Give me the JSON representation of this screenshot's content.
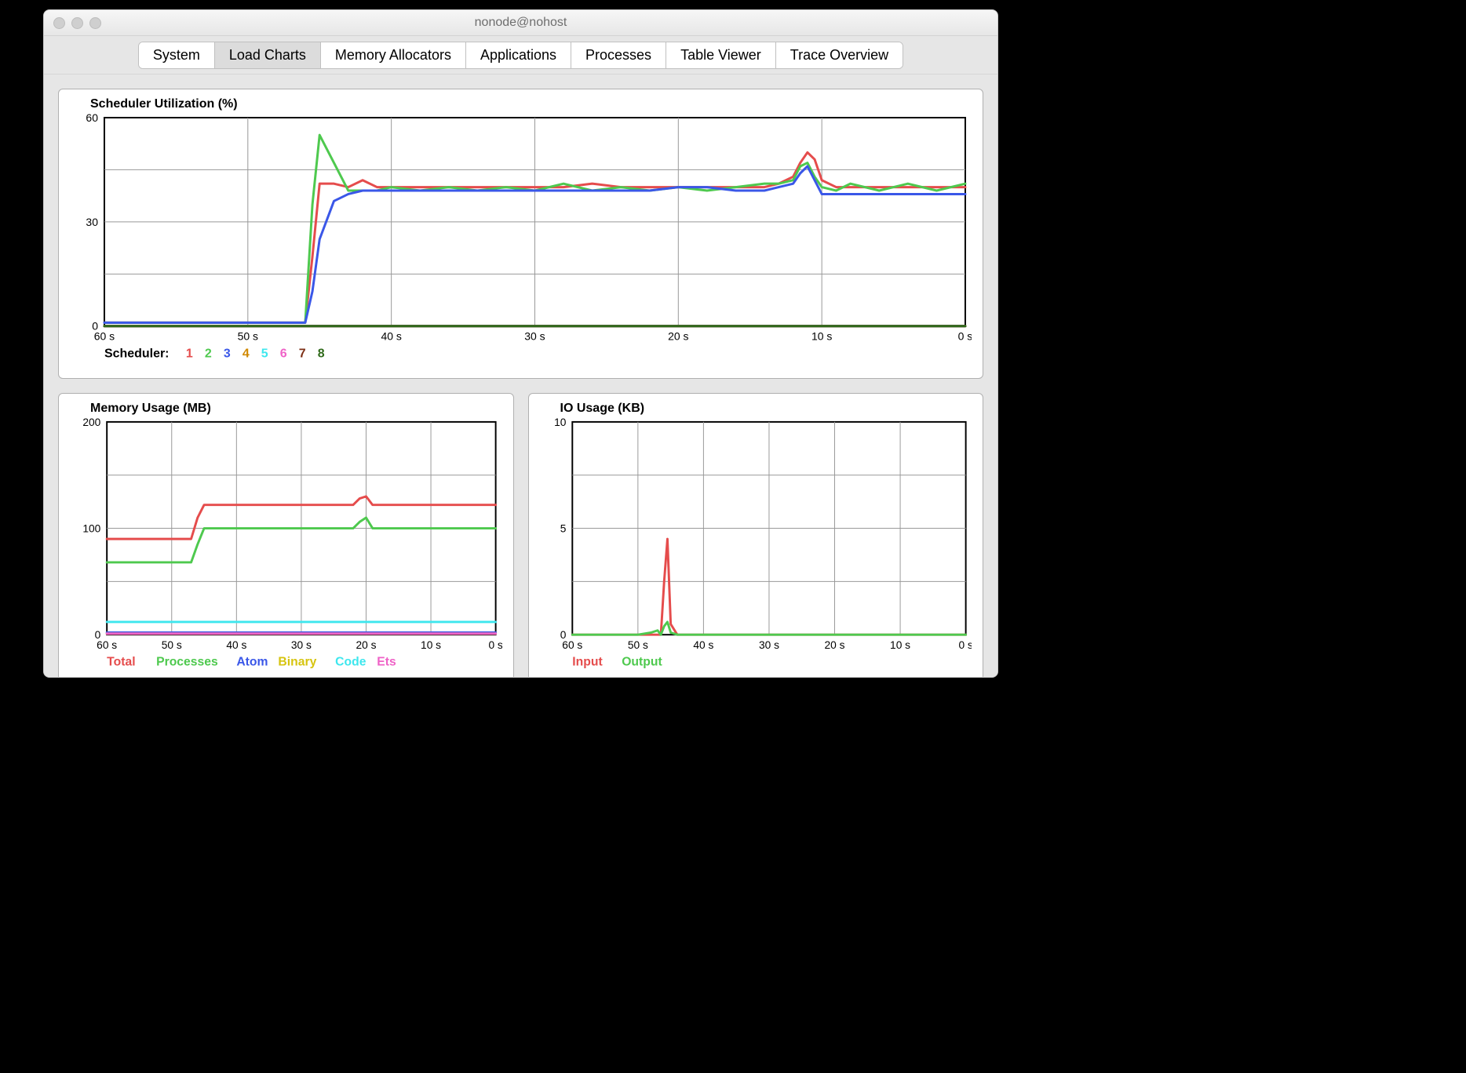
{
  "window": {
    "title": "nonode@nohost"
  },
  "tabs": {
    "selected_index": 1,
    "items": [
      "System",
      "Load Charts",
      "Memory Allocators",
      "Applications",
      "Processes",
      "Table Viewer",
      "Trace Overview"
    ]
  },
  "colors": {
    "red": "#e54c4c",
    "green": "#4ec94e",
    "blue": "#3a57e8",
    "yellow": "#d6c40f",
    "cyan": "#3ee7ee",
    "magenta": "#ef62c7",
    "darkred": "#7d2f16",
    "darkgreen": "#2f6a1a",
    "orange": "#d08800"
  },
  "chart_data": [
    {
      "id": "scheduler",
      "type": "line",
      "title": "Scheduler Utilization (%)",
      "xlabel": "",
      "ylabel": "",
      "xlim": [
        60,
        0
      ],
      "ylim": [
        0,
        60
      ],
      "x_ticks": [
        "60 s",
        "50 s",
        "40 s",
        "30 s",
        "20 s",
        "10 s",
        "0 s"
      ],
      "y_ticks": [
        0,
        30,
        60
      ],
      "legend_prefix": "Scheduler:",
      "legend": [
        {
          "name": "1",
          "color": "red"
        },
        {
          "name": "2",
          "color": "green"
        },
        {
          "name": "3",
          "color": "blue"
        },
        {
          "name": "4",
          "color": "orange"
        },
        {
          "name": "5",
          "color": "cyan"
        },
        {
          "name": "6",
          "color": "magenta"
        },
        {
          "name": "7",
          "color": "darkred"
        },
        {
          "name": "8",
          "color": "darkgreen"
        }
      ],
      "x": [
        60,
        55,
        50,
        47.5,
        46.5,
        46,
        45.5,
        45,
        44,
        43,
        42,
        41,
        40,
        38,
        36,
        34,
        32,
        30,
        28,
        26,
        24,
        22,
        20,
        18,
        16,
        14,
        13,
        12,
        11.5,
        11,
        10.5,
        10,
        9,
        8,
        6,
        4,
        2,
        0
      ],
      "series": [
        {
          "name": "1",
          "color": "red",
          "y": [
            1,
            1,
            1,
            1,
            1,
            1,
            20,
            41,
            41,
            40,
            42,
            40,
            40,
            40,
            40,
            40,
            40,
            40,
            40,
            41,
            40,
            40,
            40,
            40,
            40,
            40,
            41,
            43,
            47,
            50,
            48,
            42,
            40,
            40,
            40,
            40,
            40,
            40
          ]
        },
        {
          "name": "2",
          "color": "green",
          "y": [
            1,
            1,
            1,
            1,
            1,
            1,
            35,
            55,
            47,
            39,
            39,
            39,
            40,
            39,
            40,
            39,
            40,
            39,
            41,
            39,
            40,
            39,
            40,
            39,
            40,
            41,
            41,
            42,
            46,
            47,
            43,
            40,
            39,
            41,
            39,
            41,
            39,
            41
          ]
        },
        {
          "name": "3",
          "color": "blue",
          "y": [
            1,
            1,
            1,
            1,
            1,
            1,
            10,
            25,
            36,
            38,
            39,
            39,
            39,
            39,
            39,
            39,
            39,
            39,
            39,
            39,
            39,
            39,
            40,
            40,
            39,
            39,
            40,
            41,
            44,
            46,
            42,
            38,
            38,
            38,
            38,
            38,
            38,
            38
          ]
        },
        {
          "name": "4",
          "color": "orange",
          "y": [
            0,
            0,
            0,
            0,
            0,
            0,
            0,
            0,
            0,
            0,
            0,
            0,
            0,
            0,
            0,
            0,
            0,
            0,
            0,
            0,
            0,
            0,
            0,
            0,
            0,
            0,
            0,
            0,
            0,
            0,
            0,
            0,
            0,
            0,
            0,
            0,
            0,
            0
          ]
        },
        {
          "name": "5",
          "color": "cyan",
          "y": [
            0,
            0,
            0,
            0,
            0,
            0,
            0,
            0,
            0,
            0,
            0,
            0,
            0,
            0,
            0,
            0,
            0,
            0,
            0,
            0,
            0,
            0,
            0,
            0,
            0,
            0,
            0,
            0,
            0,
            0,
            0,
            0,
            0,
            0,
            0,
            0,
            0,
            0
          ]
        },
        {
          "name": "6",
          "color": "magenta",
          "y": [
            0,
            0,
            0,
            0,
            0,
            0,
            0,
            0,
            0,
            0,
            0,
            0,
            0,
            0,
            0,
            0,
            0,
            0,
            0,
            0,
            0,
            0,
            0,
            0,
            0,
            0,
            0,
            0,
            0,
            0,
            0,
            0,
            0,
            0,
            0,
            0,
            0,
            0
          ]
        },
        {
          "name": "7",
          "color": "darkred",
          "y": [
            0,
            0,
            0,
            0,
            0,
            0,
            0,
            0,
            0,
            0,
            0,
            0,
            0,
            0,
            0,
            0,
            0,
            0,
            0,
            0,
            0,
            0,
            0,
            0,
            0,
            0,
            0,
            0,
            0,
            0,
            0,
            0,
            0,
            0,
            0,
            0,
            0,
            0
          ]
        },
        {
          "name": "8",
          "color": "darkgreen",
          "y": [
            0,
            0,
            0,
            0,
            0,
            0,
            0,
            0,
            0,
            0,
            0,
            0,
            0,
            0,
            0,
            0,
            0,
            0,
            0,
            0,
            0,
            0,
            0,
            0,
            0,
            0,
            0,
            0,
            0,
            0,
            0,
            0,
            0,
            0,
            0,
            0,
            0,
            0
          ]
        }
      ]
    },
    {
      "id": "memory",
      "type": "line",
      "title": "Memory Usage (MB)",
      "xlim": [
        60,
        0
      ],
      "ylim": [
        0,
        200
      ],
      "x_ticks": [
        "60 s",
        "50 s",
        "40 s",
        "30 s",
        "20 s",
        "10 s",
        "0 s"
      ],
      "y_ticks": [
        0,
        100,
        200
      ],
      "legend": [
        {
          "name": "Total",
          "color": "red"
        },
        {
          "name": "Processes",
          "color": "green"
        },
        {
          "name": "Atom",
          "color": "blue"
        },
        {
          "name": "Binary",
          "color": "yellow"
        },
        {
          "name": "Code",
          "color": "cyan"
        },
        {
          "name": "Ets",
          "color": "magenta"
        }
      ],
      "x": [
        60,
        50,
        47,
        46,
        45,
        40,
        30,
        22,
        21,
        20,
        19,
        10,
        0
      ],
      "series": [
        {
          "name": "Total",
          "color": "red",
          "y": [
            90,
            90,
            90,
            110,
            122,
            122,
            122,
            122,
            128,
            130,
            122,
            122,
            122
          ]
        },
        {
          "name": "Processes",
          "color": "green",
          "y": [
            68,
            68,
            68,
            85,
            100,
            100,
            100,
            100,
            106,
            110,
            100,
            100,
            100
          ]
        },
        {
          "name": "Atom",
          "color": "blue",
          "y": [
            2,
            2,
            2,
            2,
            2,
            2,
            2,
            2,
            2,
            2,
            2,
            2,
            2
          ]
        },
        {
          "name": "Binary",
          "color": "yellow",
          "y": [
            1,
            1,
            1,
            1,
            1,
            1,
            1,
            1,
            1,
            1,
            1,
            1,
            1
          ]
        },
        {
          "name": "Code",
          "color": "cyan",
          "y": [
            12,
            12,
            12,
            12,
            12,
            12,
            12,
            12,
            12,
            12,
            12,
            12,
            12
          ]
        },
        {
          "name": "Ets",
          "color": "magenta",
          "y": [
            1,
            1,
            1,
            1,
            1,
            1,
            1,
            1,
            1,
            1,
            1,
            1,
            1
          ]
        }
      ]
    },
    {
      "id": "io",
      "type": "line",
      "title": "IO Usage (KB)",
      "xlim": [
        60,
        0
      ],
      "ylim": [
        0,
        10
      ],
      "x_ticks": [
        "60 s",
        "50 s",
        "40 s",
        "30 s",
        "20 s",
        "10 s",
        "0 s"
      ],
      "y_ticks": [
        0,
        5,
        10
      ],
      "legend": [
        {
          "name": "Input",
          "color": "red"
        },
        {
          "name": "Output",
          "color": "green"
        }
      ],
      "x": [
        60,
        50,
        48,
        47,
        46.5,
        46,
        45.5,
        45,
        44,
        40,
        30,
        20,
        10,
        0
      ],
      "series": [
        {
          "name": "Input",
          "color": "red",
          "y": [
            0,
            0,
            0,
            0,
            0,
            2.5,
            4.5,
            0.5,
            0,
            0,
            0,
            0,
            0,
            0
          ]
        },
        {
          "name": "Output",
          "color": "green",
          "y": [
            0,
            0,
            0.1,
            0.2,
            0,
            0.4,
            0.6,
            0.1,
            0,
            0,
            0,
            0,
            0,
            0
          ]
        }
      ]
    }
  ]
}
